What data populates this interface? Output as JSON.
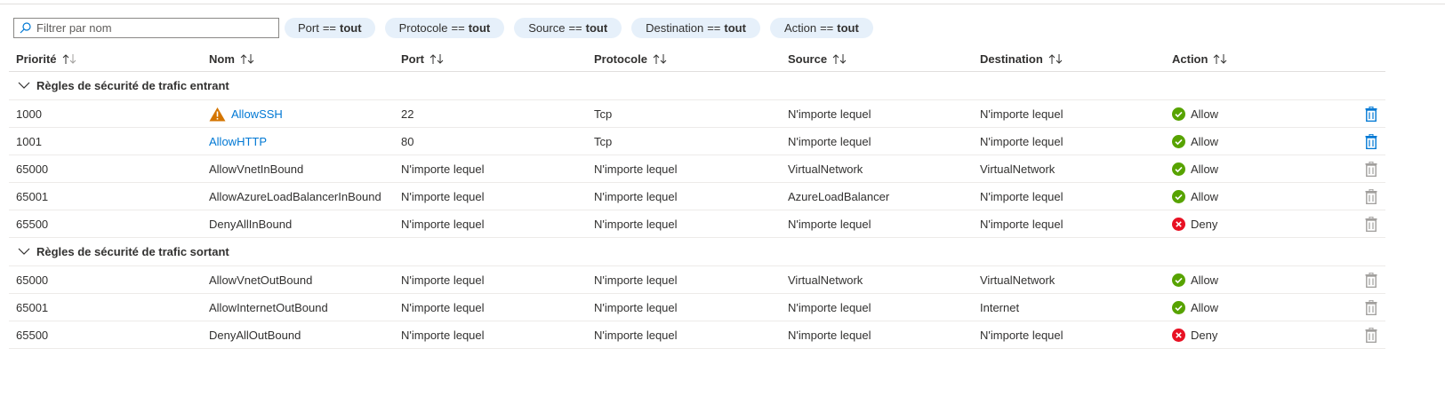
{
  "filter": {
    "placeholder": "Filtrer par nom",
    "pills": [
      {
        "field": "Port",
        "op": "==",
        "value": "tout"
      },
      {
        "field": "Protocole",
        "op": "==",
        "value": "tout"
      },
      {
        "field": "Source",
        "op": "==",
        "value": "tout"
      },
      {
        "field": "Destination",
        "op": "==",
        "value": "tout"
      },
      {
        "field": "Action",
        "op": "==",
        "value": "tout"
      }
    ]
  },
  "columns": [
    "Priorité",
    "Nom",
    "Port",
    "Protocole",
    "Source",
    "Destination",
    "Action"
  ],
  "groups": [
    {
      "label": "Règles de sécurité de trafic entrant",
      "rows": [
        {
          "priority": "1000",
          "name": "AllowSSH",
          "port": "22",
          "protocol": "Tcp",
          "source": "N'importe lequel",
          "destination": "N'importe lequel",
          "action": "Allow"
        },
        {
          "priority": "1001",
          "name": "AllowHTTP",
          "port": "80",
          "protocol": "Tcp",
          "source": "N'importe lequel",
          "destination": "N'importe lequel",
          "action": "Allow"
        },
        {
          "priority": "65000",
          "name": "AllowVnetInBound",
          "port": "N'importe lequel",
          "protocol": "N'importe lequel",
          "source": "VirtualNetwork",
          "destination": "VirtualNetwork",
          "action": "Allow"
        },
        {
          "priority": "65001",
          "name": "AllowAzureLoadBalancerInBound",
          "port": "N'importe lequel",
          "protocol": "N'importe lequel",
          "source": "AzureLoadBalancer",
          "destination": "N'importe lequel",
          "action": "Allow"
        },
        {
          "priority": "65500",
          "name": "DenyAllInBound",
          "port": "N'importe lequel",
          "protocol": "N'importe lequel",
          "source": "N'importe lequel",
          "destination": "N'importe lequel",
          "action": "Deny"
        }
      ]
    },
    {
      "label": "Règles de sécurité de trafic sortant",
      "rows": [
        {
          "priority": "65000",
          "name": "AllowVnetOutBound",
          "port": "N'importe lequel",
          "protocol": "N'importe lequel",
          "source": "VirtualNetwork",
          "destination": "VirtualNetwork",
          "action": "Allow"
        },
        {
          "priority": "65001",
          "name": "AllowInternetOutBound",
          "port": "N'importe lequel",
          "protocol": "N'importe lequel",
          "source": "N'importe lequel",
          "destination": "Internet",
          "action": "Allow"
        },
        {
          "priority": "65500",
          "name": "DenyAllOutBound",
          "port": "N'importe lequel",
          "protocol": "N'importe lequel",
          "source": "N'importe lequel",
          "destination": "N'importe lequel",
          "action": "Deny"
        }
      ]
    }
  ],
  "icons": {
    "search": "search-icon",
    "sort": "sort-arrows-icon",
    "collapse": "chevron-down-icon",
    "warning": "warning-icon",
    "allow": "check-circle-icon",
    "deny": "error-circle-icon",
    "delete": "trash-icon"
  },
  "colors": {
    "link": "#0078d4",
    "pill_bg": "#e6f0fa",
    "allow": "#57a300",
    "deny": "#e81123",
    "warning": "#d47500",
    "delete_enabled": "#0078d4",
    "delete_disabled": "#a19f9d"
  }
}
